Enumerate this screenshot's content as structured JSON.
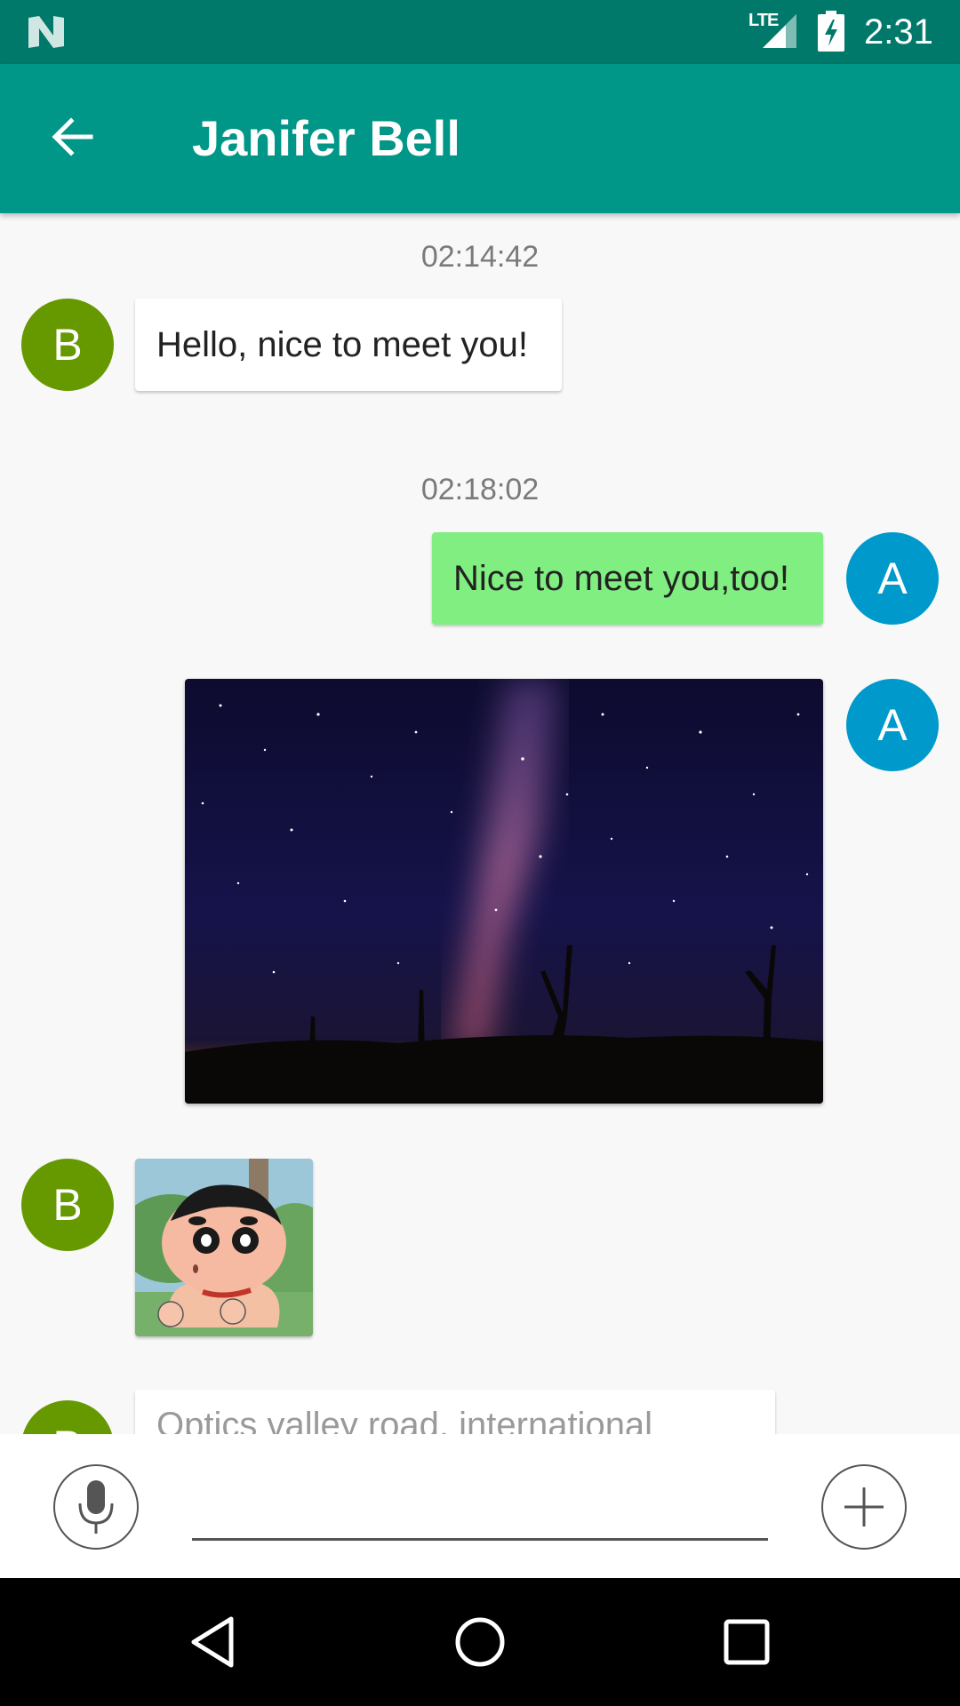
{
  "status_bar": {
    "network": "LTE",
    "time": "2:31"
  },
  "app_bar": {
    "title": "Janifer Bell"
  },
  "messages": [
    {
      "type": "timestamp",
      "text": "02:14:42"
    },
    {
      "type": "text",
      "sender": "B",
      "side": "left",
      "text": "Hello, nice to meet you!"
    },
    {
      "type": "timestamp",
      "text": "02:18:02"
    },
    {
      "type": "text",
      "sender": "A",
      "side": "right",
      "text": "Nice to meet you,too!"
    },
    {
      "type": "image",
      "sender": "A",
      "side": "right",
      "content": "milky way night sky photo"
    },
    {
      "type": "image",
      "sender": "B",
      "side": "left",
      "content": "cartoon boy sticker"
    },
    {
      "type": "text",
      "sender": "B",
      "side": "left",
      "text": "Optics valley road, international"
    }
  ],
  "input": {
    "value": "",
    "placeholder": ""
  },
  "colors": {
    "status_bar": "#00796b",
    "app_bar": "#009688",
    "avatar_b": "#669900",
    "avatar_a": "#0099cc",
    "outgoing_bubble": "#80ee80",
    "incoming_bubble": "#ffffff"
  },
  "icons": {
    "back": "arrow-left-icon",
    "mic": "mic-icon",
    "plus": "plus-icon",
    "nav_back": "triangle-back-icon",
    "nav_home": "circle-home-icon",
    "nav_recent": "square-recent-icon"
  }
}
